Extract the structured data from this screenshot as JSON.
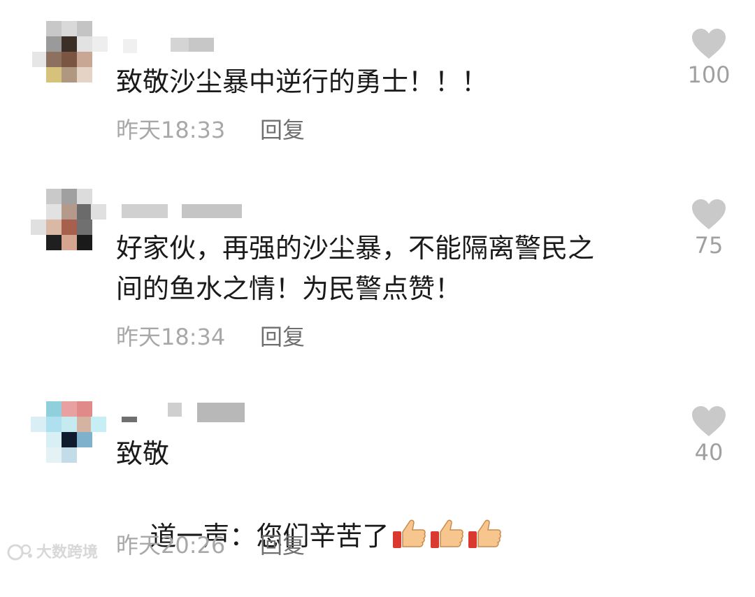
{
  "comments": [
    {
      "text": "致敬沙尘暴中逆行的勇士！！！",
      "time": "昨天18:33",
      "reply_label": "回复",
      "likes": "100"
    },
    {
      "text": "好家伙，再强的沙尘暴，不能隔离警民之\n间的鱼水之情！为民警点赞！",
      "time": "昨天18:34",
      "reply_label": "回复",
      "likes": "75"
    },
    {
      "text_line1": "致敬",
      "text_line2": "道一声：您们辛苦了",
      "emoji": "thumbs-up-icon x3",
      "time": "昨天20:26",
      "reply_label": "回复",
      "likes": "40"
    }
  ],
  "watermark": "大数跨境",
  "colors": {
    "text": "#1a1a1a",
    "meta": "#a8a8a8",
    "reply": "#6f6f6f",
    "heart": "#c9c9c9"
  }
}
